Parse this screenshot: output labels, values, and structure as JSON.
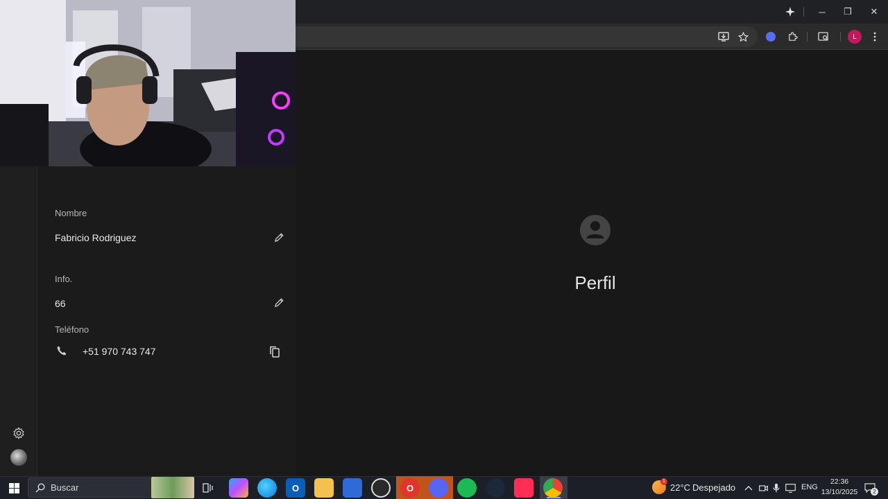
{
  "browser": {
    "window_controls": {
      "minimize": "─",
      "restore": "❐",
      "close": "✕"
    }
  },
  "profile": {
    "name_label": "Nombre",
    "name_value": "Fabricio Rodriguez",
    "info_label": "Info.",
    "info_value": "66",
    "phone_label": "Teléfono",
    "phone_value": "+51 970 743 747"
  },
  "main": {
    "title": "Perfil"
  },
  "taskbar": {
    "search_placeholder": "Buscar",
    "weather_temp": "22°C",
    "weather_desc": "Despejado",
    "weather_badge": "1",
    "language": "ENG",
    "time": "22:36",
    "date": "13/10/2025",
    "notification_count": "2"
  },
  "colors": {
    "background": "#161616",
    "accent_avatar": "#c2185b",
    "spotify": "#1db954",
    "edge": "#0c7bd7"
  }
}
